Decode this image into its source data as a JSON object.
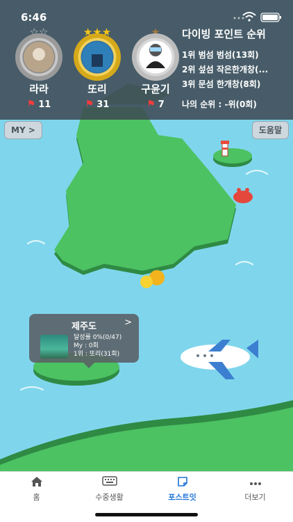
{
  "status": {
    "time": "6:46"
  },
  "rankers": [
    {
      "name": "라라",
      "count": "11",
      "stars": "☆☆"
    },
    {
      "name": "또리",
      "count": "31",
      "stars": "★★★"
    },
    {
      "name": "구윤기",
      "count": "7",
      "stars": "★"
    }
  ],
  "ranking": {
    "title": "다이빙 포인트 순위",
    "rows": [
      "1위 범섬 범섬(13회)",
      "2위 섶섬 작은한개창(...",
      "3위 문섬 한개창(8회)"
    ],
    "mine": "나의 순위 : -위(0회)"
  },
  "buttons": {
    "my": "MY >",
    "help": "도움말"
  },
  "popup": {
    "title": "제주도",
    "chevron": ">",
    "line1": "달성률 0%(0/47)",
    "line2": "My : 0회",
    "line3": "1위 : 또리(31회)"
  },
  "tabs": [
    {
      "label": "홈",
      "icon": "home-icon"
    },
    {
      "label": "수중생활",
      "icon": "keyboard-icon"
    },
    {
      "label": "포스트잇",
      "icon": "sticky-note-icon"
    },
    {
      "label": "더보기",
      "icon": "more-icon"
    }
  ],
  "colors": {
    "sea": "#7fd6ec",
    "land": "#4cc262",
    "land_dark": "#2f8a44",
    "active_tab": "#1e73d8",
    "flag": "#ff3b3b"
  }
}
